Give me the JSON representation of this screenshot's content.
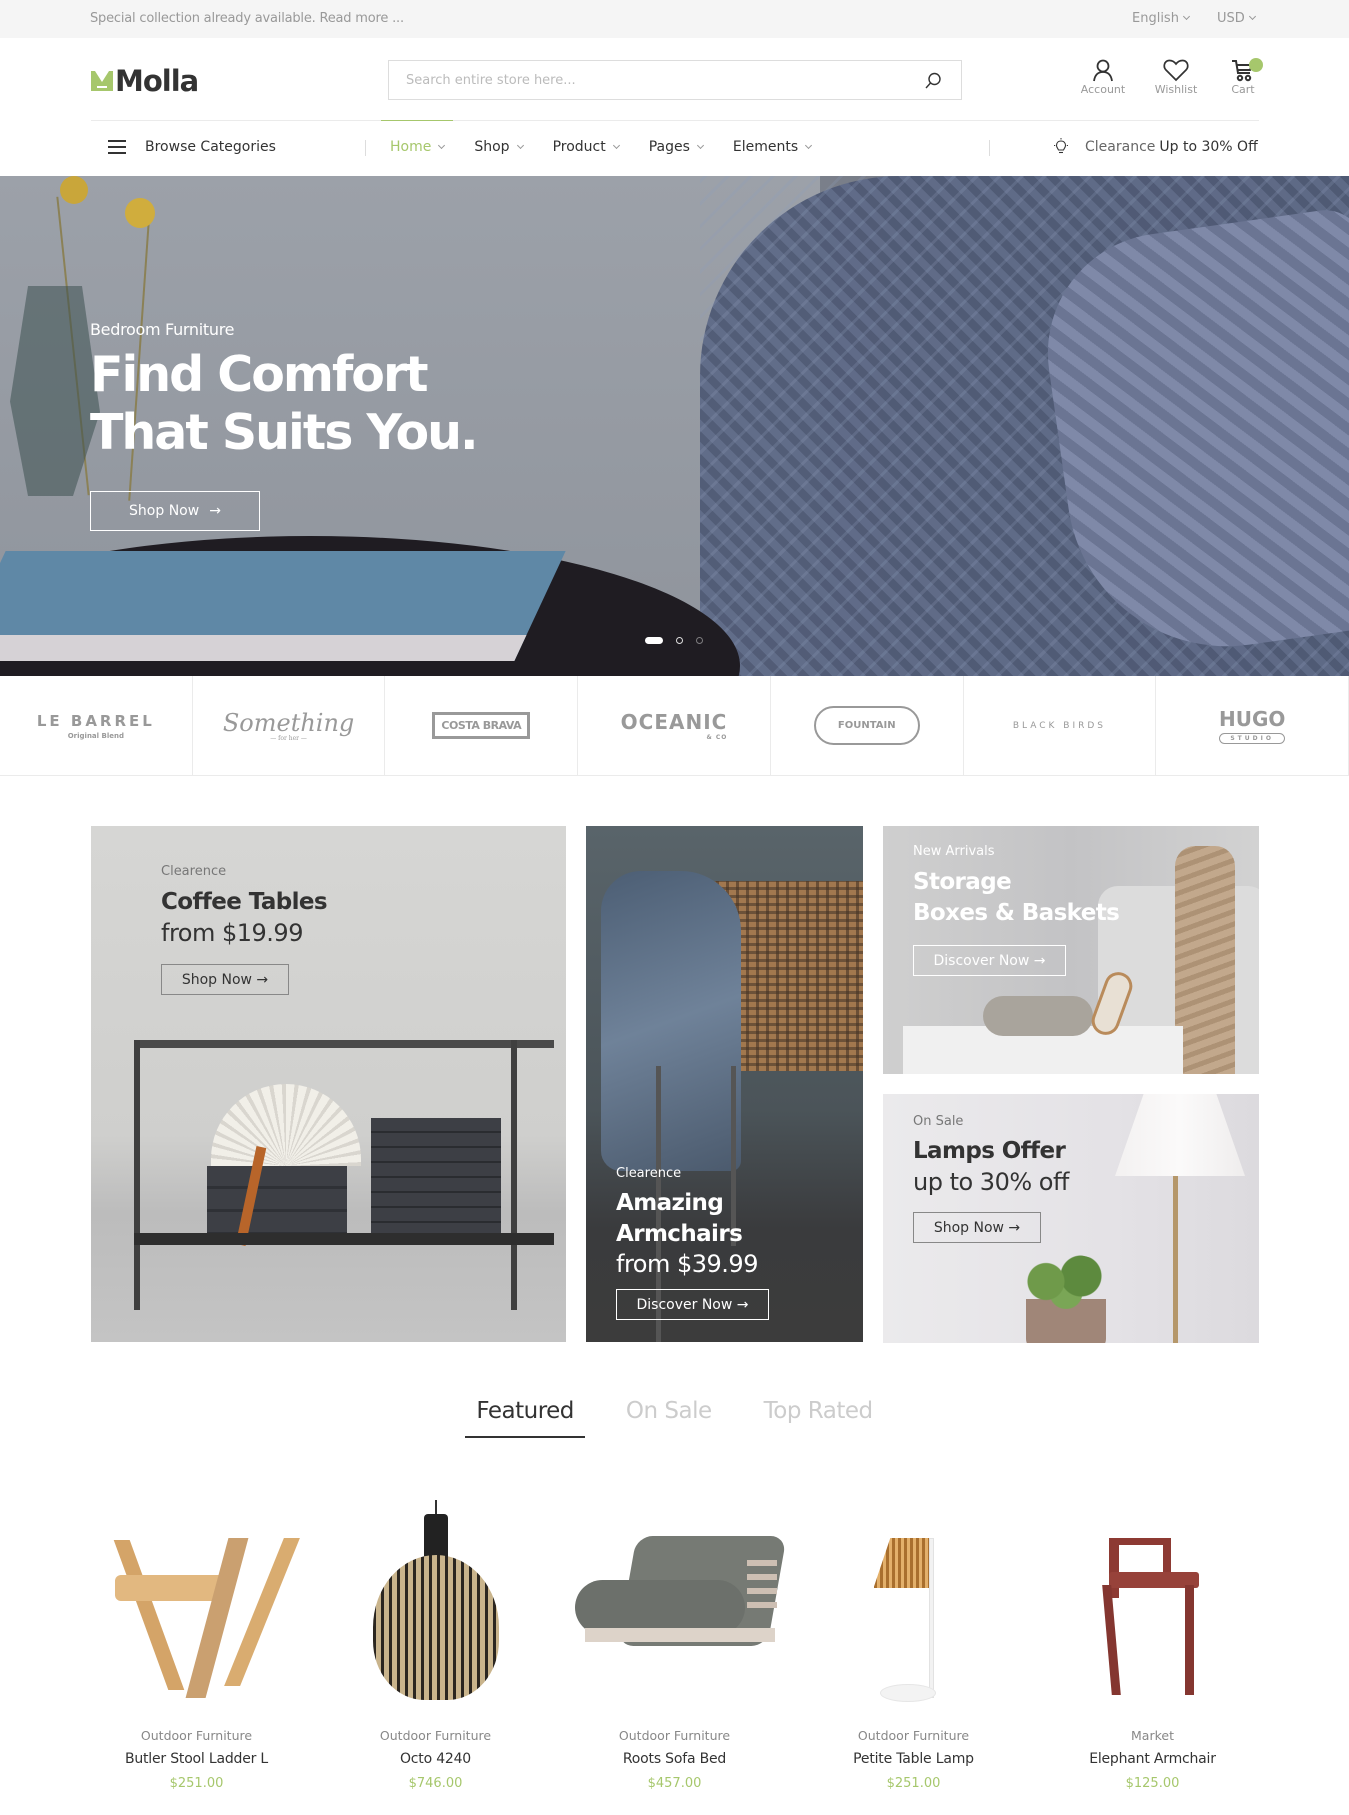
{
  "topbar": {
    "promo_text": "Special collection already available. Read more ...",
    "language": "English",
    "currency": "USD"
  },
  "header": {
    "logo_text": "Molla",
    "search_placeholder": "Search entire store here...",
    "search_value": "",
    "icons": [
      {
        "name": "user-icon",
        "label": "Account"
      },
      {
        "name": "heart-icon",
        "label": "Wishlist"
      },
      {
        "name": "cart-icon",
        "label": "Cart"
      }
    ]
  },
  "nav": {
    "browse_label": "Browse Categories",
    "menu": [
      {
        "label": "Home",
        "active": true
      },
      {
        "label": "Shop",
        "active": false
      },
      {
        "label": "Product",
        "active": false
      },
      {
        "label": "Pages",
        "active": false
      },
      {
        "label": "Elements",
        "active": false
      }
    ],
    "clearance_label": "Clearance",
    "clearance_offer": "Up to 30% Off"
  },
  "hero": {
    "subtitle": "Bedroom Furniture",
    "title_line1": "Find Comfort",
    "title_line2": "That Suits You.",
    "button_label": "Shop Now",
    "arrow": "→",
    "slides_total": 3,
    "active_slide": 1
  },
  "brands": [
    {
      "name": "LE BARREL",
      "tagline": "Original Blend"
    },
    {
      "name": "Something",
      "tagline": "— for her —"
    },
    {
      "name": "COSTA BRAVA",
      "tagline": ""
    },
    {
      "name": "OCEANIC",
      "tagline": "& CO"
    },
    {
      "name": "FOUNTAIN",
      "tagline": ""
    },
    {
      "name": "BLACK BIRDS",
      "tagline": ""
    },
    {
      "name": "HUGO",
      "tagline": "STUDIO"
    }
  ],
  "banners": {
    "coffee": {
      "subtitle": "Clearence",
      "title": "Coffee Tables",
      "price": "from $19.99",
      "button": "Shop Now →"
    },
    "armchairs": {
      "subtitle": "Clearence",
      "title_line1": "Amazing",
      "title_line2": "Armchairs",
      "price": "from $39.99",
      "button": "Discover Now →"
    },
    "storage": {
      "subtitle": "New Arrivals",
      "title_line1": "Storage",
      "title_line2": "Boxes & Baskets",
      "button": "Discover Now →"
    },
    "lamps": {
      "subtitle": "On Sale",
      "title": "Lamps Offer",
      "price": "up to 30% off",
      "button": "Shop Now →"
    }
  },
  "tabs": [
    {
      "label": "Featured",
      "active": true
    },
    {
      "label": "On Sale",
      "active": false
    },
    {
      "label": "Top Rated",
      "active": false
    }
  ],
  "products": [
    {
      "category": "Outdoor Furniture",
      "name": "Butler Stool Ladder L",
      "price": "$251.00"
    },
    {
      "category": "Outdoor Furniture",
      "name": "Octo 4240",
      "price": "$746.00"
    },
    {
      "category": "Outdoor Furniture",
      "name": "Roots Sofa Bed",
      "price": "$457.00"
    },
    {
      "category": "Outdoor Furniture",
      "name": "Petite Table Lamp",
      "price": "$251.00"
    },
    {
      "category": "Market",
      "name": "Elephant Armchair",
      "price": "$125.00"
    }
  ],
  "colors": {
    "accent": "#a6c76c",
    "text": "#333333",
    "muted": "#999999"
  }
}
